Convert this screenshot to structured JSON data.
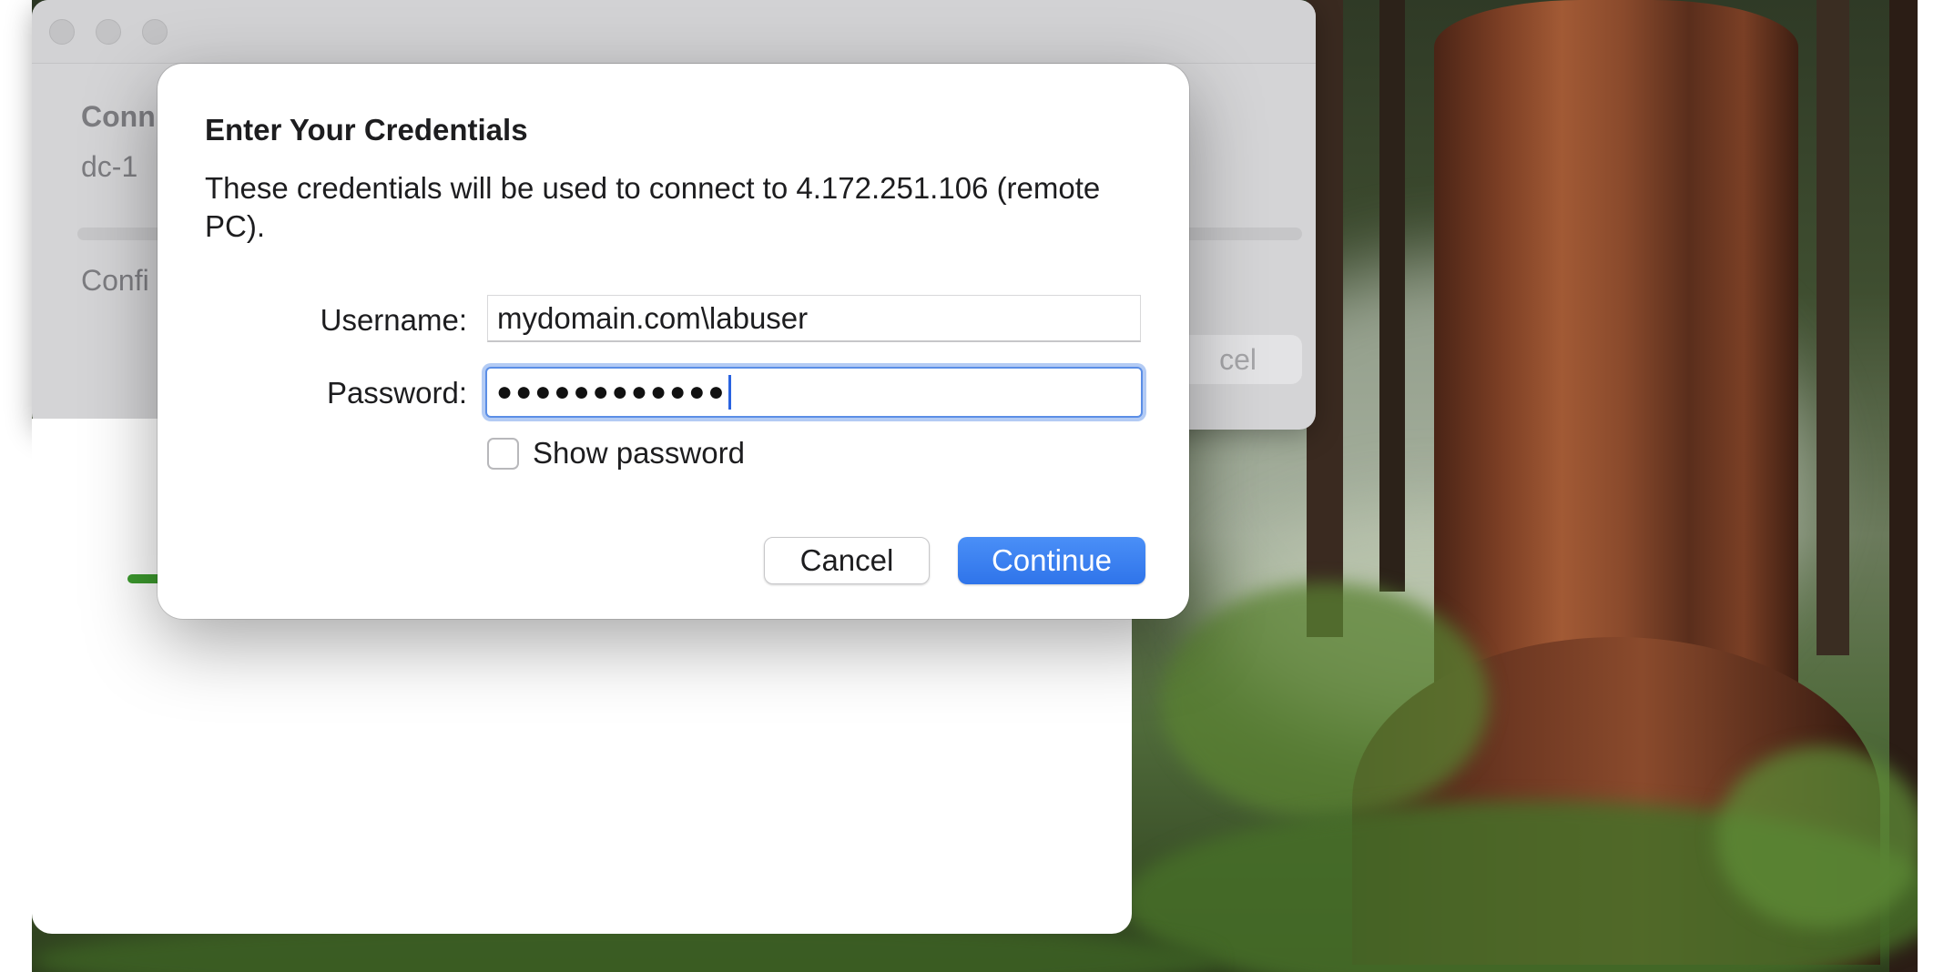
{
  "background_window": {
    "title_partial": "Conn",
    "host_partial": "dc-1",
    "status_partial": "Confi",
    "cancel_partial": "cel"
  },
  "dialog": {
    "title": "Enter Your Credentials",
    "message": "These credentials will be used to connect to 4.172.251.106 (remote PC).",
    "username_label": "Username:",
    "username_value": "mydomain.com\\labuser",
    "password_label": "Password:",
    "password_masked": "●●●●●●●●●●●●",
    "show_password_label": "Show password",
    "show_password_checked": false,
    "cancel_label": "Cancel",
    "continue_label": "Continue"
  },
  "colors": {
    "accent": "#3478f6",
    "focus_ring": "#5b8ee6",
    "progress_green": "#3c9a2e"
  }
}
